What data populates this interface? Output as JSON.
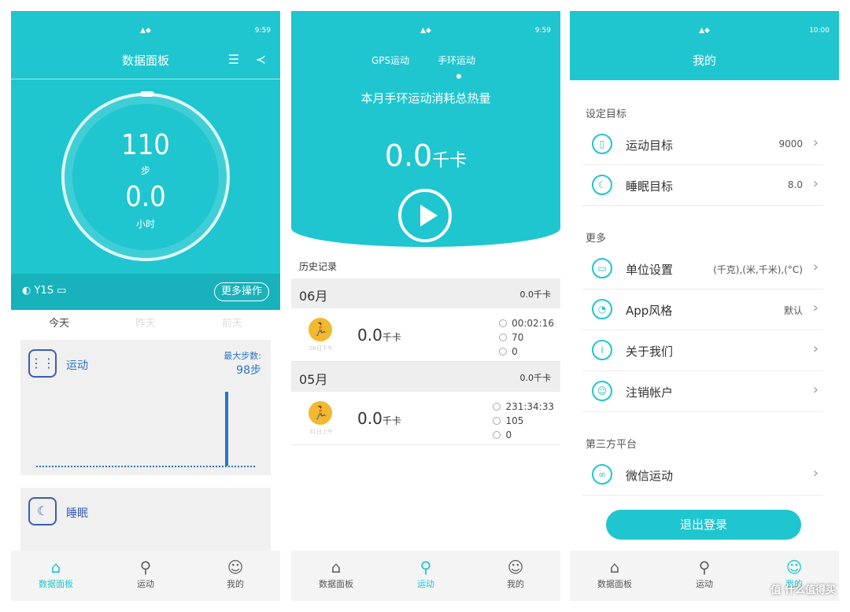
{
  "status": {
    "s1_time": "9:59",
    "s2_time": "9:59",
    "s3_time": "10:00"
  },
  "screen1": {
    "title": "数据面板",
    "steps": "110",
    "steps_unit": "步",
    "hours": "0.0",
    "hours_unit": "小时",
    "device_name": "Y1S",
    "more_button": "更多操作",
    "day_tabs": [
      "今天",
      "昨天",
      "前天"
    ],
    "activity_label": "运动",
    "max_steps_label": "最大步数:",
    "max_steps_value": "98步",
    "sleep_label": "睡眠"
  },
  "screen2": {
    "tabs": [
      "GPS运动",
      "手环运动"
    ],
    "subtitle": "本月手环运动消耗总热量",
    "kcal_value": "0.0",
    "kcal_unit": "千卡",
    "history_title": "历史记录",
    "months": [
      {
        "month": "06月",
        "total": "0.0千卡",
        "rows": [
          {
            "icon_label": "06日下午",
            "kcal": "0.0",
            "unit": "千卡",
            "stats": [
              "00:02:16",
              "70",
              "0"
            ]
          }
        ]
      },
      {
        "month": "05月",
        "total": "0.0千卡",
        "rows": [
          {
            "icon_label": "31日上午",
            "kcal": "0.0",
            "unit": "千卡",
            "stats": [
              "231:34:33",
              "105",
              "0"
            ]
          }
        ]
      }
    ]
  },
  "screen3": {
    "title": "我的",
    "sections": [
      "设定目标",
      "更多",
      "第三方平台"
    ],
    "goals": [
      {
        "icon": "watch-icon",
        "label": "运动目标",
        "value": "9000"
      },
      {
        "icon": "moon-icon",
        "label": "睡眠目标",
        "value": "8.0"
      }
    ],
    "more": [
      {
        "icon": "ruler-icon",
        "label": "单位设置",
        "value": "(千克),(米,千米),(°C)"
      },
      {
        "icon": "palette-icon",
        "label": "App风格",
        "value": "默认"
      },
      {
        "icon": "info-icon",
        "label": "关于我们",
        "value": ""
      },
      {
        "icon": "user-icon",
        "label": "注销帐户",
        "value": ""
      }
    ],
    "third_party": [
      {
        "icon": "wechat-icon",
        "label": "微信运动",
        "value": ""
      }
    ],
    "logout": "退出登录"
  },
  "nav": {
    "home": "数据面板",
    "sport": "运动",
    "mine": "我的"
  },
  "watermark": "值 什么值得买",
  "colors": {
    "accent": "#1fc6cf",
    "blue": "#2a73c8",
    "gold": "#f2b82e"
  }
}
